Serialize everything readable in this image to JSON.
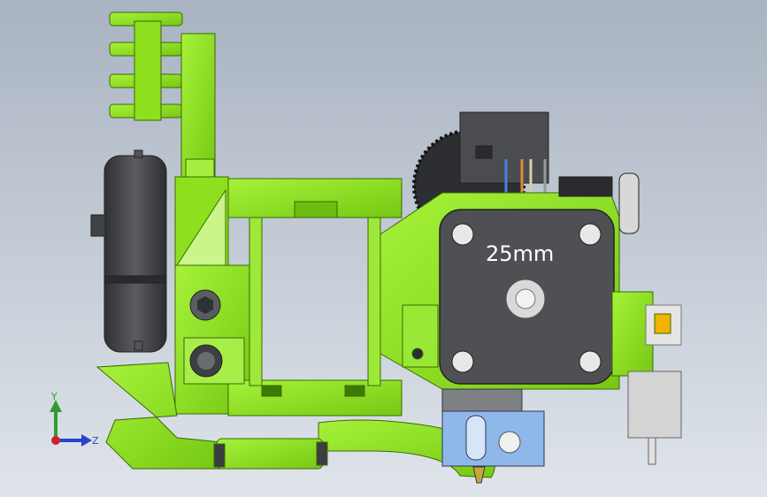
{
  "viewport": {
    "background_top": "#a9b3c1",
    "background_bottom": "#dfe4ea"
  },
  "model": {
    "motor_label": "25mm",
    "part_color": "#8ee01f",
    "part_color_dark": "#5fa60c",
    "motor_color": "#4f5053",
    "fan_color": "#3e4043",
    "hotend_color": "#8fb8ea"
  },
  "triad": {
    "y_label": "Y",
    "z_label": "Z",
    "y_color": "#2f9e2f",
    "z_color": "#2a44c9",
    "x_color": "#d0202a"
  }
}
